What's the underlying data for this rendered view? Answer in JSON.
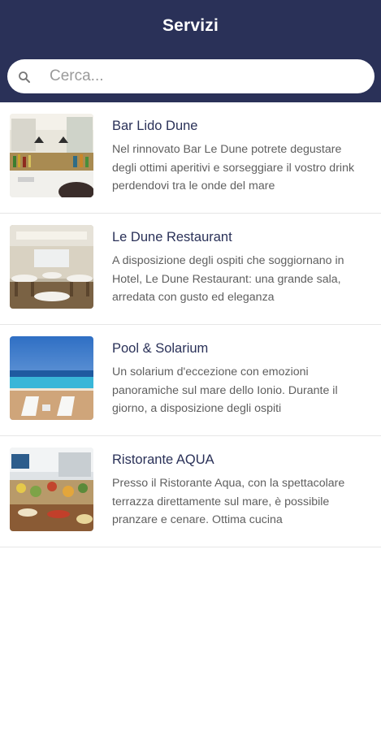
{
  "header": {
    "title": "Servizi"
  },
  "search": {
    "placeholder": "Cerca...",
    "icon": "search-icon"
  },
  "colors": {
    "header_bg": "#2a3158",
    "title_text": "#2a3158",
    "desc_text": "#5f5f5f"
  },
  "items": [
    {
      "title": "Bar Lido Dune",
      "description": "Nel rinnovato Bar Le Dune potrete degustare degli ottimi aperitivi e sorseggiare il vostro drink perdendovi tra le onde del mare",
      "image": "bar-photo"
    },
    {
      "title": "Le Dune Restaurant",
      "description": "A disposizione degli ospiti che soggiornano in Hotel, Le Dune Restaurant: una grande sala, arredata con gusto ed eleganza",
      "image": "restaurant-photo"
    },
    {
      "title": "Pool & Solarium",
      "description": "Un solarium d'eccezione con emozioni panoramiche sul mare dello Ionio. Durante il giorno, a disposizione degli ospiti",
      "image": "pool-photo"
    },
    {
      "title": "Ristorante AQUA",
      "description": "Presso il Ristorante Aqua, con la spettacolare terrazza direttamente sul mare, è possibile pranzare e cenare. Ottima cucina",
      "image": "buffet-photo"
    }
  ]
}
